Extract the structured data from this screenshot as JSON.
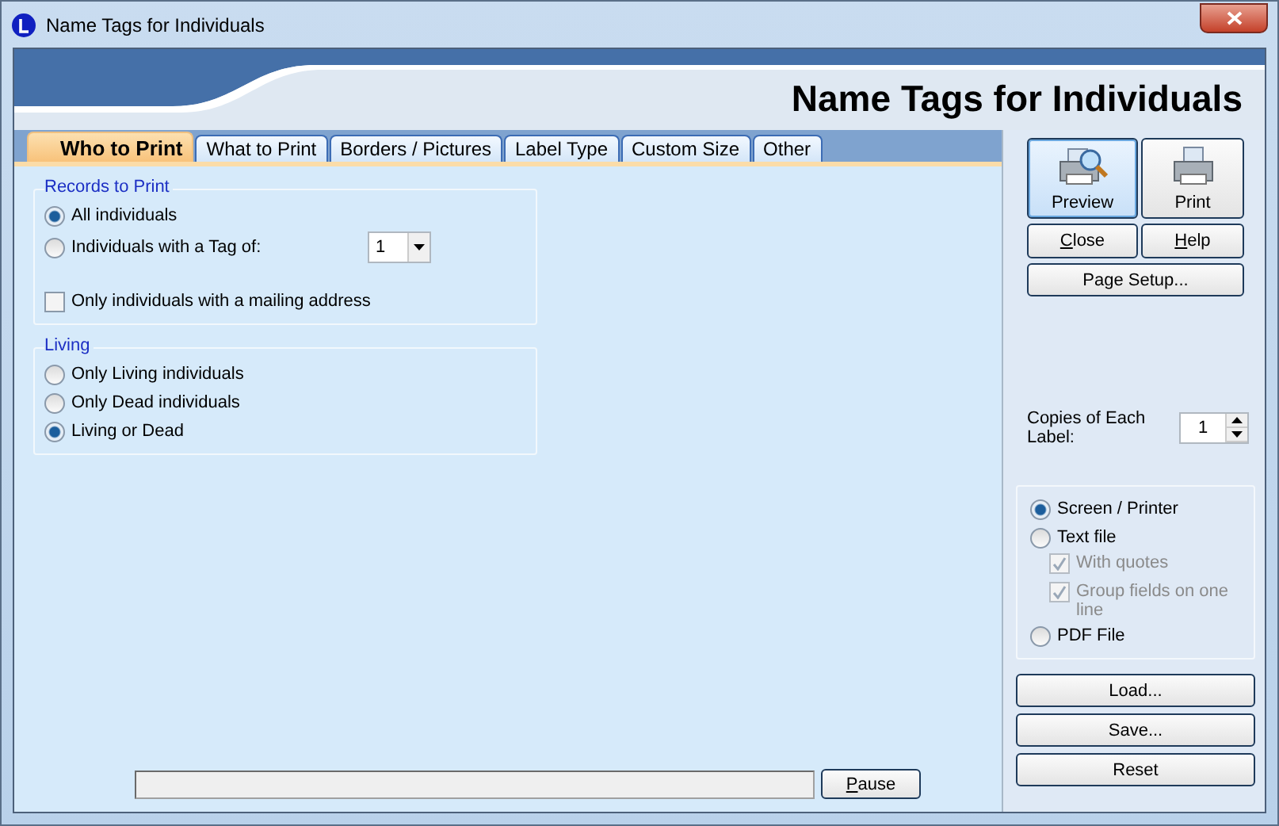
{
  "window": {
    "title": "Name Tags for Individuals"
  },
  "header": {
    "title": "Name Tags for Individuals"
  },
  "tabs": [
    {
      "label": "Who to Print",
      "selected": true
    },
    {
      "label": "What to Print",
      "selected": false
    },
    {
      "label": "Borders / Pictures",
      "selected": false
    },
    {
      "label": "Label Type",
      "selected": false
    },
    {
      "label": "Custom Size",
      "selected": false
    },
    {
      "label": "Other",
      "selected": false
    }
  ],
  "records_group": {
    "legend": "Records to Print",
    "options": [
      {
        "label": "All individuals",
        "selected": true
      },
      {
        "label": "Individuals with a Tag of:",
        "selected": false
      }
    ],
    "tag_value": "1",
    "mailing_only": {
      "label": "Only individuals with a mailing address",
      "checked": false
    }
  },
  "living_group": {
    "legend": "Living",
    "options": [
      {
        "label": "Only Living individuals",
        "selected": false
      },
      {
        "label": "Only Dead individuals",
        "selected": false
      },
      {
        "label": "Living or Dead",
        "selected": true
      }
    ]
  },
  "progress": {
    "level": 0
  },
  "pause_button": {
    "label": "Pause",
    "underline_first": true
  },
  "big_buttons": [
    {
      "label": "Preview",
      "kind": "preview",
      "selected": true
    },
    {
      "label": "Print",
      "kind": "print",
      "selected": false
    }
  ],
  "small_buttons": [
    {
      "label": "Close",
      "underline_first": true
    },
    {
      "label": "Help",
      "underline_first": true
    }
  ],
  "page_setup": "Page Setup...",
  "copies": {
    "label": "Copies of Each Label:",
    "value": "1"
  },
  "output": [
    {
      "kind": "radio",
      "label": "Screen / Printer",
      "selected": true
    },
    {
      "kind": "radio",
      "label": "Text file",
      "selected": false
    },
    {
      "kind": "checkbox",
      "label": "With quotes",
      "checked": true,
      "disabled": true
    },
    {
      "kind": "checkbox",
      "label": "Group fields on one line",
      "checked": true,
      "disabled": true
    },
    {
      "kind": "radio",
      "label": "PDF File",
      "selected": false
    }
  ],
  "bottom_buttons": [
    "Load...",
    "Save...",
    "Reset"
  ]
}
